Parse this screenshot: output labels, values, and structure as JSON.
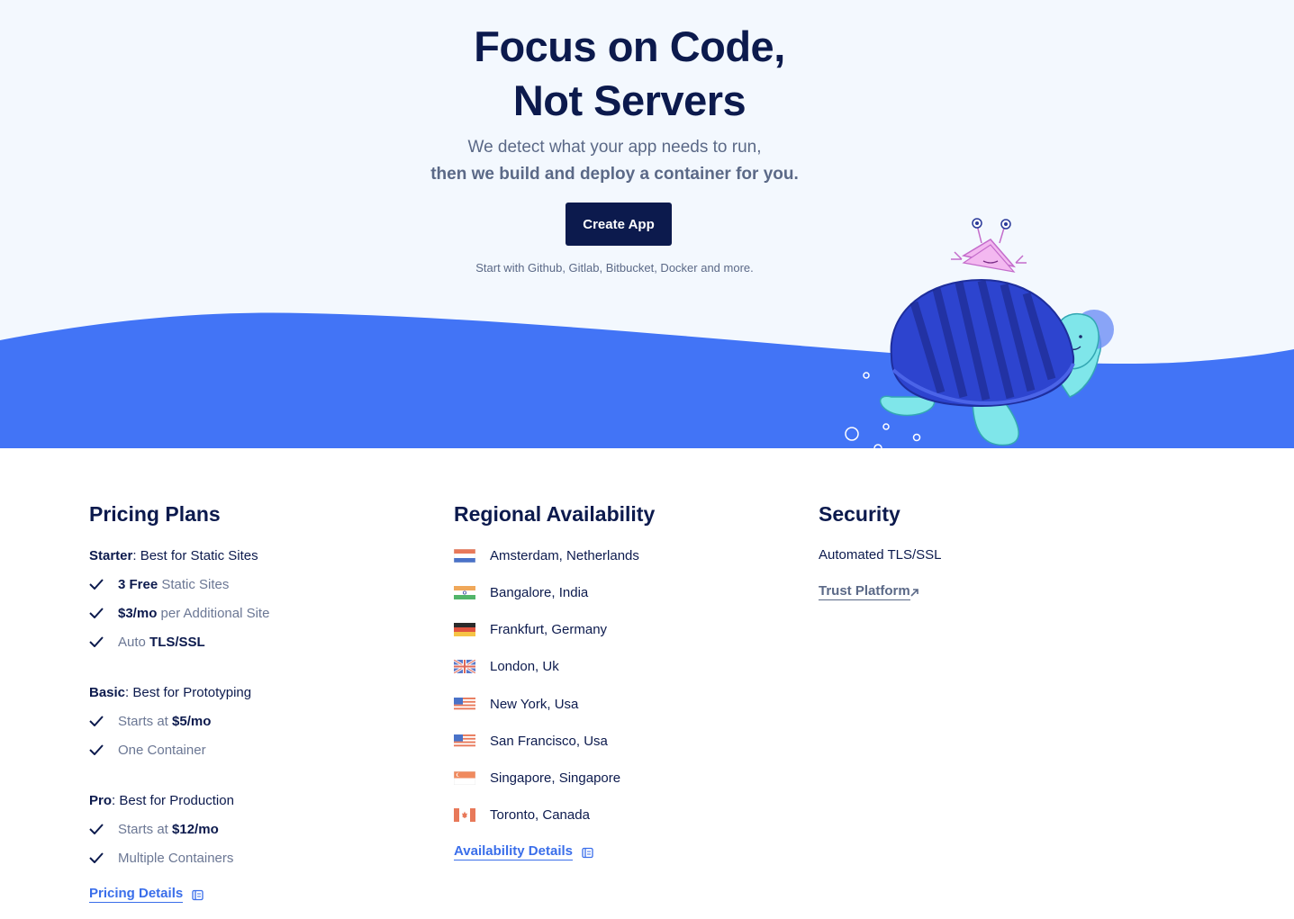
{
  "hero": {
    "title_line1": "Focus on Code,",
    "title_line2": "Not Servers",
    "subtitle_line1": "We detect what your app needs to run,",
    "subtitle_line2": "then we build and deploy a container for you.",
    "cta_label": "Create App",
    "note": "Start with Github, Gitlab, Bitbucket, Docker and more.",
    "wave_color": "#4274f6"
  },
  "pricing": {
    "heading": "Pricing Plans",
    "starter": {
      "name": "Starter",
      "desc": ": Best for Static Sites",
      "f1_strong": "3 Free",
      "f1_rest": " Static Sites",
      "f2_strong": "$3/mo",
      "f2_rest": " per Additional Site",
      "f3_pre": "Auto ",
      "f3_strong": "TLS/SSL"
    },
    "basic": {
      "name": "Basic",
      "desc": ": Best for Prototyping",
      "f1_pre": "Starts at ",
      "f1_strong": "$5/mo",
      "f2": "One Container"
    },
    "pro": {
      "name": "Pro",
      "desc": ": Best for Production",
      "f1_pre": "Starts at ",
      "f1_strong": "$12/mo",
      "f2": "Multiple Containers"
    },
    "details_link": "Pricing Details"
  },
  "regions": {
    "heading": "Regional Availability",
    "items": [
      {
        "label": "Amsterdam, Netherlands",
        "flag": "netherlands-flag-icon"
      },
      {
        "label": "Bangalore, India",
        "flag": "india-flag-icon"
      },
      {
        "label": "Frankfurt, Germany",
        "flag": "germany-flag-icon"
      },
      {
        "label": "London, Uk",
        "flag": "uk-flag-icon"
      },
      {
        "label": "New York, Usa",
        "flag": "usa-flag-icon"
      },
      {
        "label": "San Francisco, Usa",
        "flag": "usa-flag-icon"
      },
      {
        "label": "Singapore, Singapore",
        "flag": "singapore-flag-icon"
      },
      {
        "label": "Toronto, Canada",
        "flag": "canada-flag-icon"
      }
    ],
    "details_link": "Availability Details"
  },
  "security": {
    "heading": "Security",
    "item": "Automated TLS/SSL",
    "link": "Trust Platform"
  }
}
